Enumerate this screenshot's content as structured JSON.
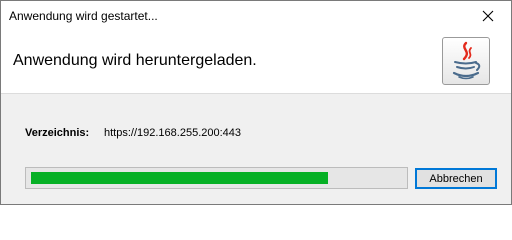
{
  "window": {
    "title": "Anwendung wird gestartet...",
    "close_icon": "close-icon"
  },
  "header": {
    "heading": "Anwendung wird heruntergeladen.",
    "logo_icon": "java-coffee-cup-icon"
  },
  "info": {
    "label": "Verzeichnis:",
    "value": "https://192.168.255.200:443"
  },
  "progress": {
    "fraction": 0.8,
    "color": "#06b025"
  },
  "actions": {
    "cancel_label": "Abbrechen"
  },
  "colors": {
    "accent_border": "#0078d7",
    "logo_red": "#e32a1c",
    "logo_blue": "#4a6b8c"
  }
}
